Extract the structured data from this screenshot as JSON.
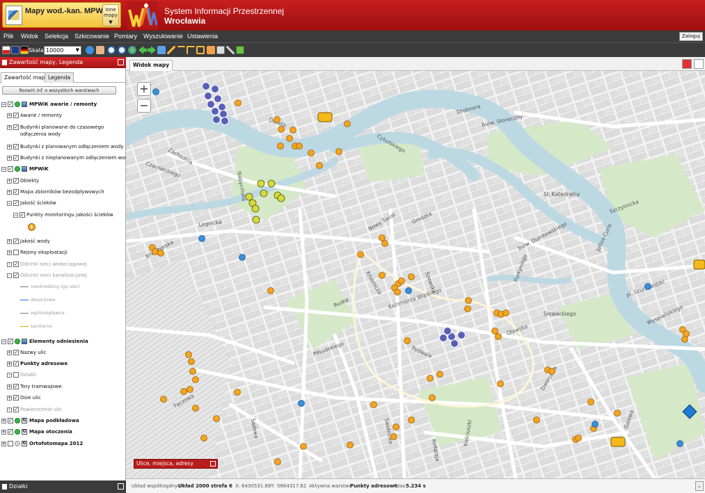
{
  "header": {
    "app_title": "Mapy wod.-kan. MPWiK",
    "other_maps": "Inne mapy",
    "system_line1": "System Informacji Przestrzennej",
    "system_line2": "Wrocławia"
  },
  "menu": {
    "items": [
      "Plik",
      "Widok",
      "Selekcja",
      "Szkicowanie",
      "Pomiary",
      "Wyszukiwanie",
      "Ustawienia"
    ],
    "login": "Zaloguj"
  },
  "toolbar": {
    "scale_label": "Skala:",
    "scale_value": "10000",
    "icons": [
      "flag-pl-icon",
      "flag-uk-icon",
      "flag-de-icon",
      "info-icon",
      "pan-hand-icon",
      "zoom-in-icon",
      "zoom-out-icon",
      "globe-icon",
      "back-arrow-icon",
      "forward-arrow-icon",
      "full-extent-icon",
      "pencil-icon",
      "measure-line-icon",
      "measure-angle-icon",
      "crop-icon",
      "layers-icon",
      "print-icon",
      "link-icon",
      "export-icon"
    ]
  },
  "left_panel": {
    "title": "Zawartość mapy, Legenda",
    "tabs": [
      "Zawartość mapy",
      "Legenda"
    ],
    "expand_button": "Rozwiń inf. o wszystkich warstwach",
    "layers": {
      "g1": "MPWiK awarie / remonty",
      "g1_1": "Awarie / remonty",
      "g1_2": "Budynki planowane do czasowego odłączenia wody",
      "g1_3": "Budynki z planowanym odłączeniem wody",
      "g1_4": "Budynki z nieplanowanym odłączeniem wody",
      "g2": "MPWiK",
      "g2_1": "Obiekty",
      "g2_2": "Mapa zbiorników bezodpływowych",
      "g2_3": "Jakość ścieków",
      "g2_3_1": "Punkty monitoringu jakości ścieków",
      "g2_4": "Jakość wody",
      "g2_5": "Rejony eksploatacji",
      "g2_6": "Odcinki sieci wodociągowej",
      "g2_7": "Odcinki sieci kanalizacyjnej",
      "leg1": "nieokreślony typ sieci",
      "leg2": "deszczowa",
      "leg3": "ogólnospławna",
      "leg4": "sanitarna",
      "g3": "Elementy odniesienia",
      "g3_1": "Nazwy ulic",
      "g3_2": "Punkty adresowe",
      "g3_3": "Działki",
      "g3_4": "Tory tramwajowe",
      "g3_5": "Osie ulic",
      "g3_6": "Powierzchnie ulic",
      "g4": "Mapa podkładowa",
      "g5": "Mapa otoczenia",
      "g6": "Ortofotomapa 2012"
    },
    "bottom_panel": "Działki"
  },
  "map": {
    "tab": "Widok mapy",
    "search_box": "Ulice, miejsca, adresy",
    "streets": [
      "Drobnera",
      "bulw. Słoneczny",
      "Dubois",
      "Nowy Świat",
      "Grodzka",
      "Legnicka",
      "Braniborska",
      "bulw. Dunikowskiego",
      "Purkyniego",
      "pl. Grunwaldzki",
      "Oławska",
      "Podwale",
      "Kazimierza Wielkiego",
      "Świdnicka",
      "Jolliot-Curie",
      "Szczytnicka",
      "Cybulskiego",
      "Wyspiańskiego",
      "Gajowa",
      "Kościuszki",
      "Nabycińska",
      "Sł. Katedralny",
      "Słowackiego",
      "Ruska",
      "Krupnicza",
      "Szewska",
      "Piłsudskiego",
      "Kołłątaja",
      "Zachodnia",
      "Czarnieckiego",
      "Tęczowa",
      "Sądowa",
      "Dworcowa"
    ],
    "zoom_in": "+",
    "zoom_out": "−"
  },
  "status": {
    "coord_label": "Układ współrzędnych",
    "coord_system": "Układ 2000 strefa 6",
    "x_label": "X:",
    "x_value": "6430531.88",
    "y_label": "Y:",
    "y_value": "5664317.62",
    "active_label": "Aktywna warstwa",
    "active_value": "Punkty adresowe",
    "time_label": "Czas",
    "time_value": "5.234 s"
  },
  "colors": {
    "header_red": "#c81e1e",
    "dark_bar": "#3b3b3b",
    "river": "#bcd9e3",
    "park": "#cfe6c4",
    "marker_orange": "#f2a521",
    "marker_blue": "#3b8fd6",
    "marker_purple": "#5a5fb6"
  }
}
